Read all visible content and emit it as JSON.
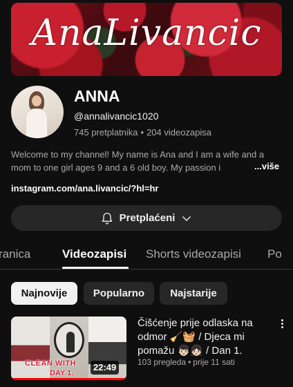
{
  "banner": {
    "title": "AnaLivancic"
  },
  "channel": {
    "name": "ANNA",
    "handle": "@annalivancic1020",
    "subscribers": "745 pretplatnika",
    "separator": "•",
    "videos": "204 videozapisa",
    "description": "Welcome to my channel! My name is Ana and I am a wife and a mom to one girl ages 9 and a 6 old boy. My passion i",
    "more_label": "...više",
    "link": "instagram.com/ana.livancic/?hl=hr",
    "subscribe_label": "Pretplaćeni"
  },
  "tabs": [
    {
      "label": "ranica",
      "active": false
    },
    {
      "label": "Videozapisi",
      "active": true
    },
    {
      "label": "Shorts videozapisi",
      "active": false
    },
    {
      "label": "Po",
      "active": false
    }
  ],
  "filters": [
    {
      "label": "Najnovije",
      "active": true
    },
    {
      "label": "Popularno",
      "active": false
    },
    {
      "label": "Najstarije",
      "active": false
    }
  ],
  "videos": [
    {
      "title": "Čišćenje prije odlaska na odmor 🧹🧺 / Djeca mi pomažu 👦🏻👧🏻 / Dan 1.",
      "views": "103 pregleda",
      "separator": "•",
      "age": "prije 11 sati",
      "duration": "22:49",
      "thumb_text_1": "CLEAN WITH",
      "thumb_text_2": "DAY 1.",
      "watched_progress": 1.0
    }
  ],
  "colors": {
    "background": "#0f0f0f",
    "chip": "#272727",
    "progress": "#ff0000",
    "muted_text": "#aaaaaa"
  },
  "icons": [
    "bell-icon",
    "chevron-down-icon",
    "more-vert-icon"
  ]
}
